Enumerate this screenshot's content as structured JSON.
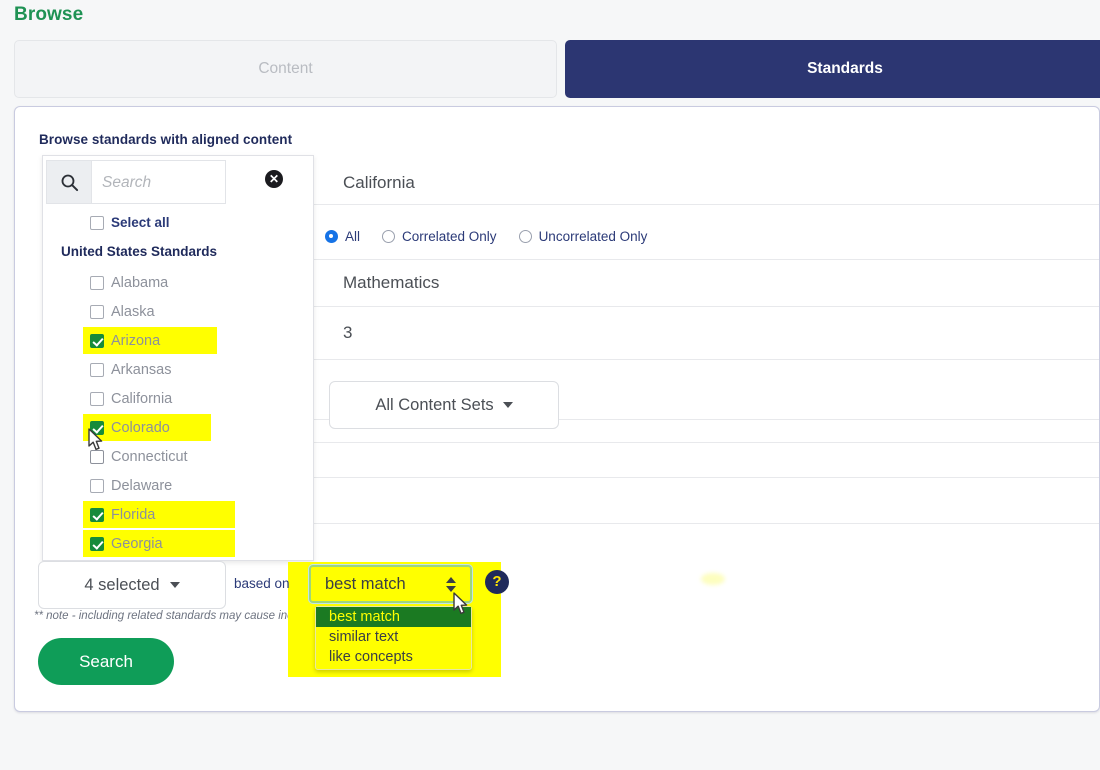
{
  "page": {
    "title": "Browse",
    "title_color": "#1f9254"
  },
  "tabs": [
    {
      "id": "content",
      "label": "Content",
      "active": false
    },
    {
      "id": "standards",
      "label": "Standards",
      "active": true
    }
  ],
  "card": {
    "heading": "Browse standards with aligned content"
  },
  "filter_popover": {
    "search": {
      "placeholder": "Search",
      "value": "",
      "icon": "search-icon",
      "clear_icon": "clear-circle-icon"
    },
    "select_all_label": "Select all",
    "group_title": "United States Standards",
    "states": [
      {
        "label": "Alabama",
        "checked": false,
        "highlighted": false,
        "hl_width": 0
      },
      {
        "label": "Alaska",
        "checked": false,
        "highlighted": false,
        "hl_width": 0
      },
      {
        "label": "Arizona",
        "checked": true,
        "highlighted": true,
        "hl_width": 134
      },
      {
        "label": "Arkansas",
        "checked": false,
        "highlighted": false,
        "hl_width": 0
      },
      {
        "label": "California",
        "checked": false,
        "highlighted": false,
        "hl_width": 0
      },
      {
        "label": "Colorado",
        "checked": true,
        "highlighted": true,
        "hl_width": 128
      },
      {
        "label": "Connecticut",
        "checked": false,
        "highlighted": false,
        "hl_width": 0
      },
      {
        "label": "Delaware",
        "checked": false,
        "highlighted": false,
        "hl_width": 0
      },
      {
        "label": "Florida",
        "checked": true,
        "highlighted": true,
        "hl_width": 152
      },
      {
        "label": "Georgia",
        "checked": true,
        "highlighted": true,
        "hl_width": 152
      }
    ]
  },
  "detail_panel": {
    "state_value": "California",
    "correlation_options": [
      {
        "label": "All",
        "selected": true
      },
      {
        "label": "Correlated Only",
        "selected": false
      },
      {
        "label": "Uncorrelated Only",
        "selected": false
      }
    ],
    "subject_value": "Mathematics",
    "grade_value": "3",
    "content_sets_label": "All Content Sets"
  },
  "bottom_bar": {
    "selected_label": "4 selected",
    "based_on_label": "based on",
    "note": "** note - including related standards may cause incr",
    "search_label": "Search",
    "help_icon": "question-mark-icon",
    "sort_select": {
      "value": "best match",
      "open": true,
      "options": [
        {
          "label": "best match",
          "selected": true
        },
        {
          "label": "similar text",
          "selected": false
        },
        {
          "label": "like concepts",
          "selected": false
        }
      ]
    }
  },
  "colors": {
    "brand_green": "#1f9254",
    "tab_active_navy": "#2c3672",
    "highlight_yellow": "#ffff00",
    "checkbox_green": "#168b3a",
    "search_button_green": "#0f9d58",
    "radio_blue": "#1673e6",
    "menu_selected_green": "#1b7a22"
  }
}
